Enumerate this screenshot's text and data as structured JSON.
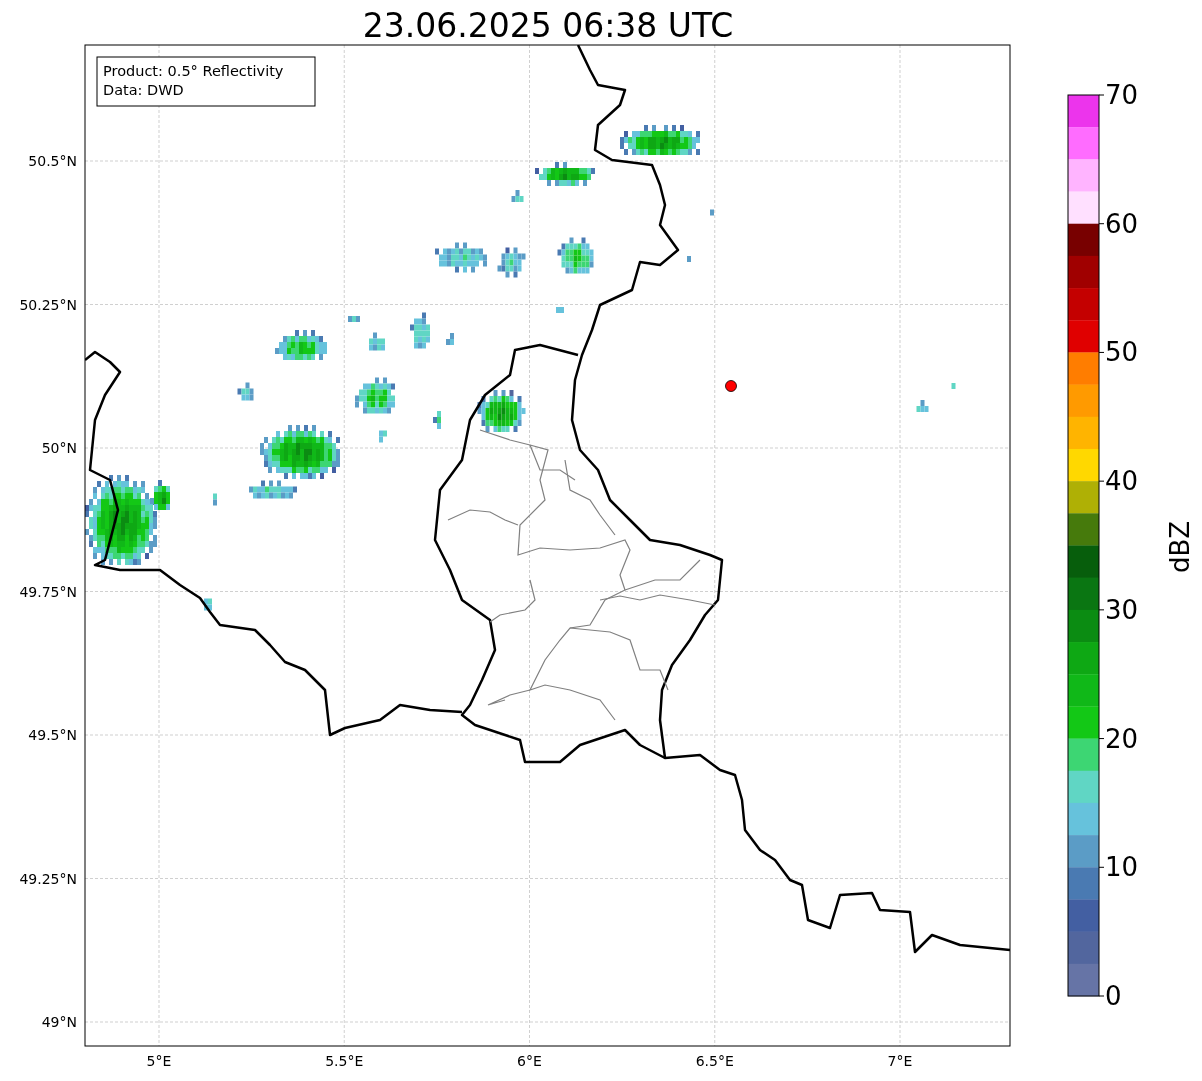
{
  "title": "23.06.2025 06:38 UTC",
  "info_box": {
    "lines": [
      "Product: 0.5° Reflectivity",
      "Data: DWD"
    ]
  },
  "map": {
    "lat_labels": [
      "50.5°N",
      "50.25°N",
      "50°N",
      "49.75°N",
      "49.5°N",
      "49.25°N",
      "49°N"
    ],
    "lon_labels": [
      "5°E",
      "5.5°E",
      "6°E",
      "6.5°E",
      "7°E"
    ]
  },
  "colorbar": {
    "label": "dBZ",
    "ticks": [
      "70",
      "60",
      "50",
      "40",
      "30",
      "20",
      "10",
      "0"
    ],
    "bands": [
      {
        "color": "#ec34ec"
      },
      {
        "color": "#ff6cff"
      },
      {
        "color": "#ffb4ff"
      },
      {
        "color": "#ffe0ff"
      },
      {
        "color": "#780000"
      },
      {
        "color": "#a00000"
      },
      {
        "color": "#c40000"
      },
      {
        "color": "#e00000"
      },
      {
        "color": "#ff7d00"
      },
      {
        "color": "#ff9a00"
      },
      {
        "color": "#ffb400"
      },
      {
        "color": "#ffd800"
      },
      {
        "color": "#afb005"
      },
      {
        "color": "#467a0c"
      },
      {
        "color": "#075e0c"
      },
      {
        "color": "#0a7612"
      },
      {
        "color": "#0b8c12"
      },
      {
        "color": "#0ea814"
      },
      {
        "color": "#10b818"
      },
      {
        "color": "#13c816"
      },
      {
        "color": "#3dd673"
      },
      {
        "color": "#60d6c4"
      },
      {
        "color": "#66c2dc"
      },
      {
        "color": "#5b9cc6"
      },
      {
        "color": "#4a7ab2"
      },
      {
        "color": "#435fa2"
      },
      {
        "color": "#52669e"
      },
      {
        "color": "#6674a6"
      }
    ]
  }
}
